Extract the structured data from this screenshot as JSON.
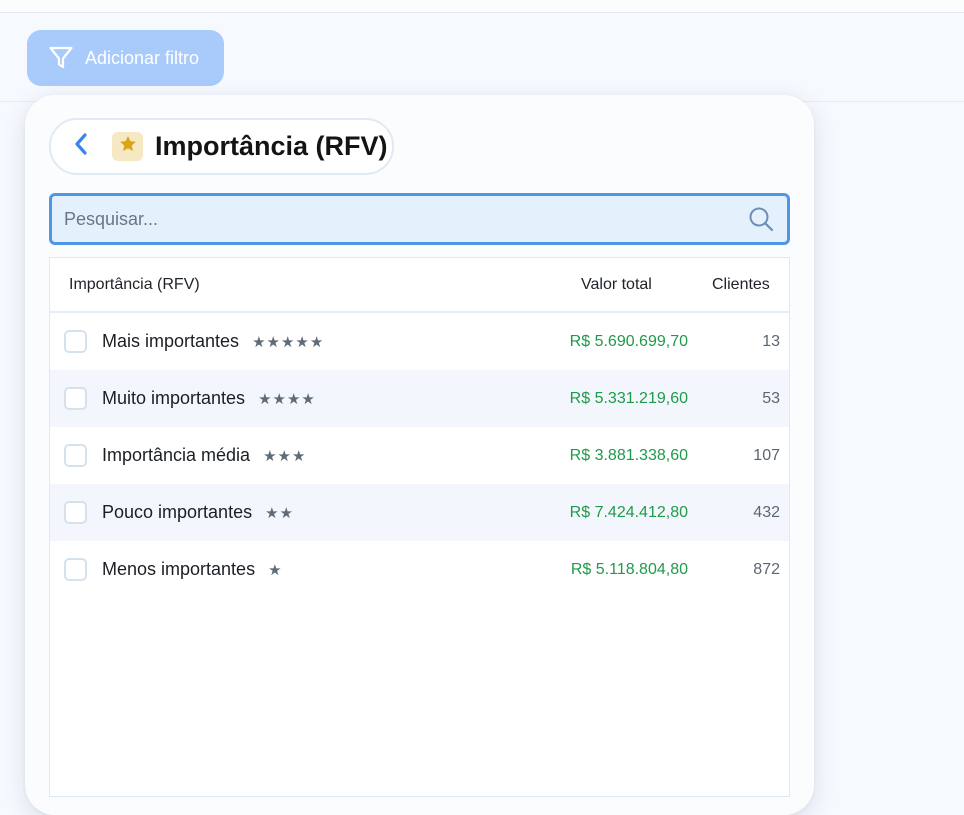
{
  "toolbar": {
    "filter_button_label": "Adicionar filtro",
    "filter_icon": "filter-icon"
  },
  "panel": {
    "title": "Importância (RFV)",
    "back_icon": "chevron-left-icon",
    "title_icon": "star-icon",
    "search": {
      "placeholder": "Pesquisar...",
      "value": "",
      "icon": "search-icon"
    },
    "table": {
      "headers": {
        "name": "Importância (RFV)",
        "value": "Valor total",
        "clients": "Clientes"
      },
      "rows": [
        {
          "label": "Mais importantes",
          "stars": "★★★★★",
          "value": "R$ 5.690.699,70",
          "clients": "13",
          "checked": false
        },
        {
          "label": "Muito importantes",
          "stars": "★★★★",
          "value": "R$ 5.331.219,60",
          "clients": "53",
          "checked": false
        },
        {
          "label": "Importância média",
          "stars": "★★★",
          "value": "R$ 3.881.338,60",
          "clients": "107",
          "checked": false
        },
        {
          "label": "Pouco importantes",
          "stars": "★★",
          "value": "R$ 7.424.412,80",
          "clients": "432",
          "checked": false
        },
        {
          "label": "Menos importantes",
          "stars": "★",
          "value": "R$ 5.118.804,80",
          "clients": "872",
          "checked": false
        }
      ]
    }
  },
  "colors": {
    "accent": "#4f96e6",
    "filter_button": "#a9cbfb",
    "value_green": "#1f9a4a",
    "star_gold": "#d9a514",
    "star_badge_bg": "#f6e8c2"
  }
}
